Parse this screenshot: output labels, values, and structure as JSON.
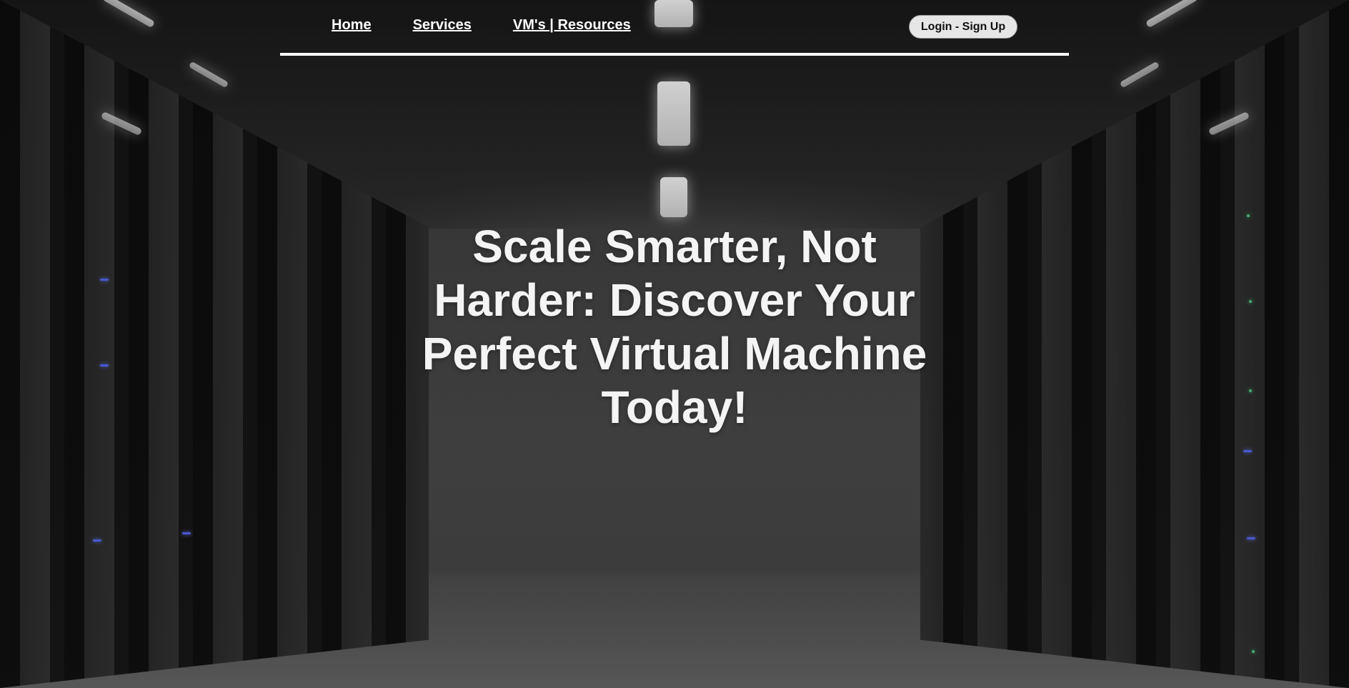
{
  "nav": {
    "links": [
      {
        "label": "Home"
      },
      {
        "label": "Services"
      },
      {
        "label": "VM's | Resources"
      }
    ],
    "login_label": "Login - Sign Up"
  },
  "hero": {
    "headline": "Scale Smarter, Not Harder: Discover Your Perfect Virtual Machine Today!"
  },
  "background": {
    "description_icon": "server-room-background"
  },
  "colors": {
    "nav_text": "#ffffff",
    "nav_rule": "#ffffff",
    "button_bg": "#e6e6e6",
    "button_text": "#111111",
    "hero_text": "#f4f4f4"
  }
}
